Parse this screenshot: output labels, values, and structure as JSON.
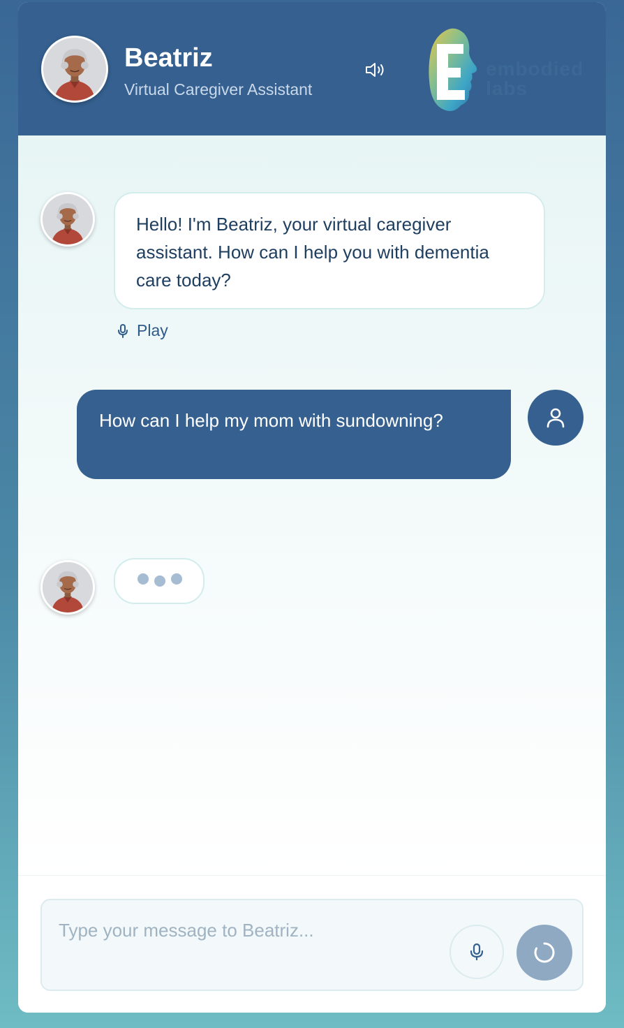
{
  "header": {
    "name": "Beatriz",
    "subtitle": "Virtual Caregiver Assistant",
    "speaker_icon": "speaker-icon",
    "logo_text": "embodied labs"
  },
  "messages": [
    {
      "role": "assistant",
      "text": "Hello! I'm Beatriz, your virtual caregiver assistant. How can I help you with dementia care today?",
      "play_label": "Play"
    },
    {
      "role": "user",
      "text": "How can I help my mom with sundowning?"
    },
    {
      "role": "assistant",
      "typing": true
    }
  ],
  "composer": {
    "placeholder": "Type your message to Beatriz...",
    "mic_icon": "microphone-icon",
    "send_icon": "loading-spinner-icon"
  },
  "colors": {
    "primary": "#35608f",
    "chat_bg": "#e8f5f5",
    "bot_bubble": "#ffffff",
    "user_bubble": "#35608f",
    "send_button": "#8fa9c3"
  }
}
